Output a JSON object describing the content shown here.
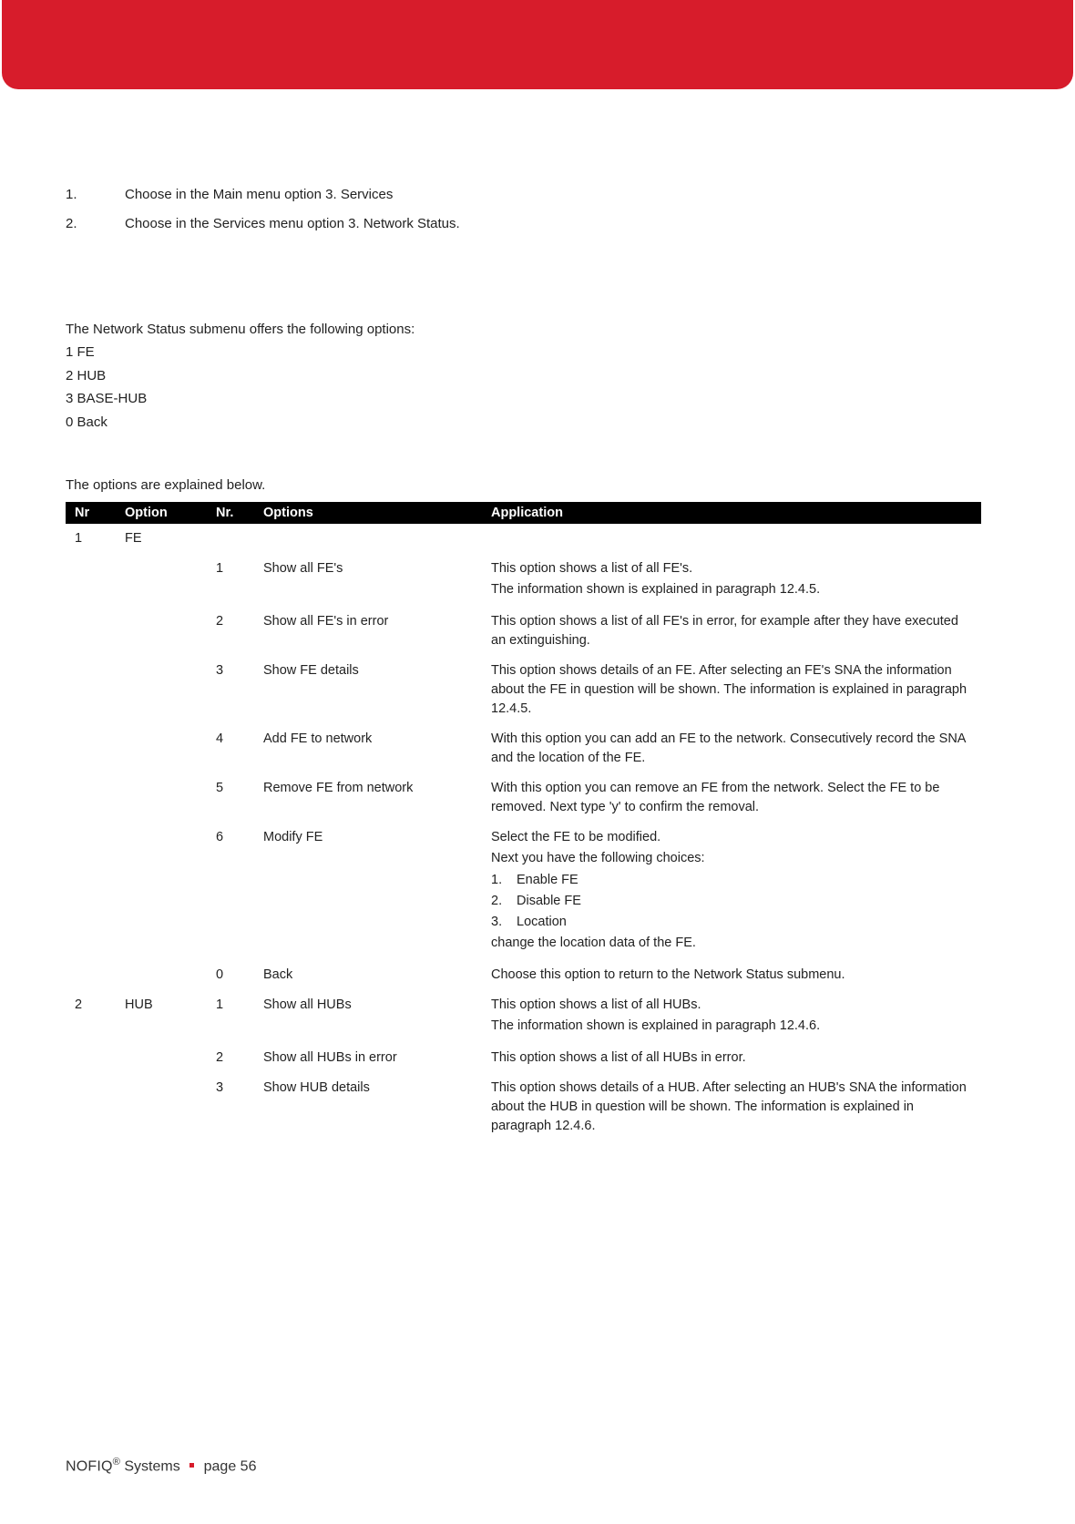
{
  "steps": [
    {
      "num": "1.",
      "text": "Choose in the Main menu option 3. Services"
    },
    {
      "num": "2.",
      "text": "Choose in the Services menu option 3. Network Status."
    }
  ],
  "intro": {
    "line1": "The Network Status submenu offers the following options:",
    "line2": "1 FE",
    "line3": "2 HUB",
    "line4": "3 BASE-HUB",
    "line5": "0 Back"
  },
  "explain": "The options are explained below.",
  "headers": {
    "nr": "Nr",
    "option": "Option",
    "nr2": "Nr.",
    "options": "Options",
    "application": "Application"
  },
  "sec1": {
    "nr": "1",
    "opt": "FE"
  },
  "sec2": {
    "nr": "2",
    "opt": "HUB"
  },
  "r": {
    "r1": {
      "n": "1",
      "o": "Show all FE's",
      "a1": "This option shows a list of all FE's.",
      "a2": "The information shown is explained in paragraph 12.4.5."
    },
    "r2": {
      "n": "2",
      "o": "Show all FE's in error",
      "a": "This option shows a list of all FE's in error, for example after they have executed an extinguishing."
    },
    "r3": {
      "n": "3",
      "o": "Show FE details",
      "a": "This option shows details of an FE. After selecting an FE's SNA the information about the FE in question will be shown. The information is explained in paragraph 12.4.5."
    },
    "r4": {
      "n": "4",
      "o": "Add FE to network",
      "a": "With this option you can add an FE to the network. Consecutively record the SNA and the location of the FE."
    },
    "r5": {
      "n": "5",
      "o": "Remove FE from network",
      "a": "With this option you can remove an FE from the network. Select the FE to be removed. Next type 'y' to confirm the removal."
    },
    "r6": {
      "n": "6",
      "o": "Modify FE",
      "a1": "Select the FE to be modified.",
      "a2": "Next you have the following choices:",
      "s1n": "1.",
      "s1t": "Enable FE",
      "s2n": "2.",
      "s2t": "Disable FE",
      "s3n": "3.",
      "s3t": "Location",
      "a3": "change the location data of the FE."
    },
    "r7": {
      "n": "0",
      "o": "Back",
      "a": "Choose this option to return to the Network Status submenu."
    },
    "h1": {
      "n": "1",
      "o": "Show all HUBs",
      "a1": "This option shows a list of all HUBs.",
      "a2": "The information shown is explained in paragraph 12.4.6."
    },
    "h2": {
      "n": "2",
      "o": "Show all HUBs in error",
      "a": "This option shows a list of all HUBs in error."
    },
    "h3": {
      "n": "3",
      "o": "Show HUB details",
      "a": "This option shows details of a HUB. After selecting an HUB's SNA the information about the HUB in question will be shown. The information is explained in paragraph 12.4.6."
    }
  },
  "footer": {
    "brand": "NOFIQ",
    "reg": "®",
    "systems": " Systems",
    "page": "page 56"
  },
  "chart_data": {
    "type": "table",
    "title": "Network Status options",
    "columns": [
      "Nr",
      "Option",
      "Nr.",
      "Options",
      "Application"
    ],
    "rows": [
      [
        "1",
        "FE",
        "1",
        "Show all FE's",
        "This option shows a list of all FE's. The information shown is explained in paragraph 12.4.5."
      ],
      [
        "",
        "",
        "2",
        "Show all FE's in error",
        "This option shows a list of all FE's in error, for example after they have executed an extinguishing."
      ],
      [
        "",
        "",
        "3",
        "Show FE details",
        "This option shows details of an FE. After selecting an FE's SNA the information about the FE in question will be shown. The information is explained in paragraph 12.4.5."
      ],
      [
        "",
        "",
        "4",
        "Add FE to network",
        "With this option you can add an FE to the network. Consecutively record the SNA and the location of the FE."
      ],
      [
        "",
        "",
        "5",
        "Remove FE from network",
        "With this option you can remove an FE from the network. Select the FE to be removed. Next type 'y' to confirm the removal."
      ],
      [
        "",
        "",
        "6",
        "Modify FE",
        "Select the FE to be modified. Next you have the following choices: 1. Enable FE 2. Disable FE 3. Location — change the location data of the FE."
      ],
      [
        "",
        "",
        "0",
        "Back",
        "Choose this option to return to the Network Status submenu."
      ],
      [
        "2",
        "HUB",
        "1",
        "Show all HUBs",
        "This option shows a list of all HUBs. The information shown is explained in paragraph 12.4.6."
      ],
      [
        "",
        "",
        "2",
        "Show all HUBs in error",
        "This option shows a list of all HUBs in error."
      ],
      [
        "",
        "",
        "3",
        "Show HUB details",
        "This option shows details of a HUB. After selecting an HUB's SNA the information about the HUB in question will be shown. The information is explained in paragraph 12.4.6."
      ]
    ]
  }
}
